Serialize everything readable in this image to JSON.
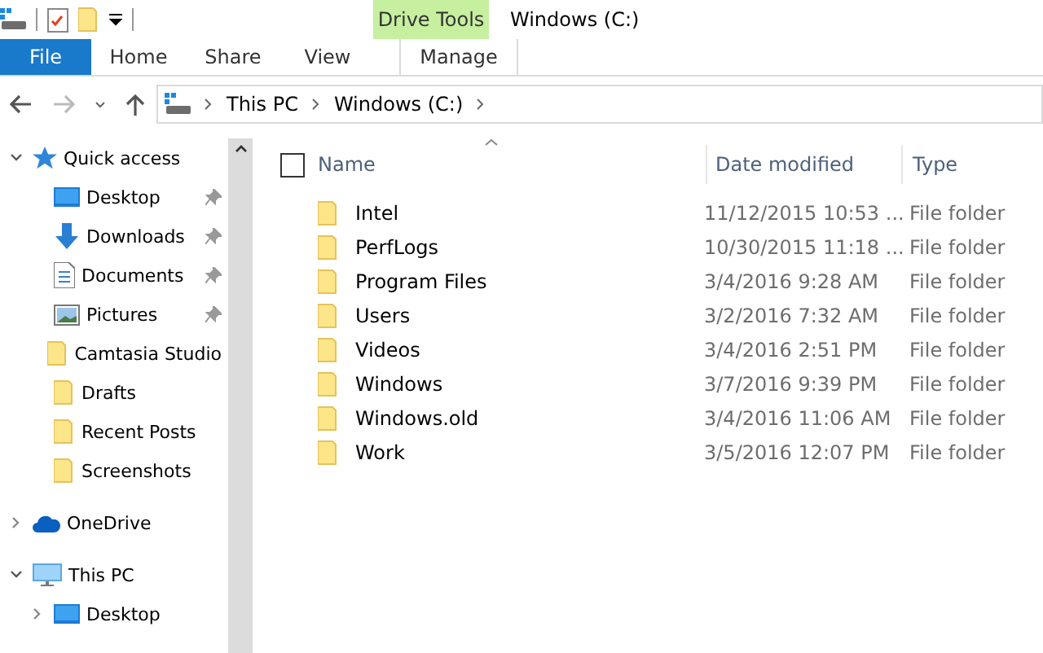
{
  "window": {
    "title": "Windows (C:)",
    "context_tab": {
      "label": "Drive Tools",
      "sub_label": "Manage"
    }
  },
  "ribbon_tabs": [
    {
      "label": "File",
      "selected": true
    },
    {
      "label": "Home",
      "selected": false
    },
    {
      "label": "Share",
      "selected": false
    },
    {
      "label": "View",
      "selected": false
    }
  ],
  "address": {
    "crumbs": [
      "This PC",
      "Windows (C:)"
    ]
  },
  "sidebar": [
    {
      "label": "Quick access",
      "kind": "star",
      "expanded": true,
      "children": [
        {
          "label": "Desktop",
          "kind": "desktop",
          "pinned": true
        },
        {
          "label": "Downloads",
          "kind": "download",
          "pinned": true
        },
        {
          "label": "Documents",
          "kind": "document",
          "pinned": true
        },
        {
          "label": "Pictures",
          "kind": "pictures",
          "pinned": true
        },
        {
          "label": "Camtasia Studio",
          "kind": "folder",
          "pinned": false
        },
        {
          "label": "Drafts",
          "kind": "folder",
          "pinned": false
        },
        {
          "label": "Recent Posts",
          "kind": "folder",
          "pinned": false
        },
        {
          "label": "Screenshots",
          "kind": "folder",
          "pinned": false
        }
      ]
    },
    {
      "label": "OneDrive",
      "kind": "cloud",
      "expanded": false
    },
    {
      "label": "This PC",
      "kind": "pc",
      "expanded": true,
      "children": [
        {
          "label": "Desktop",
          "kind": "desktop",
          "expanded": false
        }
      ]
    }
  ],
  "table": {
    "columns": [
      "Name",
      "Date modified",
      "Type"
    ],
    "select_all_checked": false,
    "rows": [
      {
        "name": "Intel",
        "date": "11/12/2015 10:53 ...",
        "type": "File folder"
      },
      {
        "name": "PerfLogs",
        "date": "10/30/2015 11:18 ...",
        "type": "File folder"
      },
      {
        "name": "Program Files",
        "date": "3/4/2016 9:28 AM",
        "type": "File folder"
      },
      {
        "name": "Users",
        "date": "3/2/2016 7:32 AM",
        "type": "File folder"
      },
      {
        "name": "Videos",
        "date": "3/4/2016 2:51 PM",
        "type": "File folder"
      },
      {
        "name": "Windows",
        "date": "3/7/2016 9:39 PM",
        "type": "File folder"
      },
      {
        "name": "Windows.old",
        "date": "3/4/2016 11:06 AM",
        "type": "File folder"
      },
      {
        "name": "Work",
        "date": "3/5/2016 12:07 PM",
        "type": "File folder"
      }
    ]
  }
}
